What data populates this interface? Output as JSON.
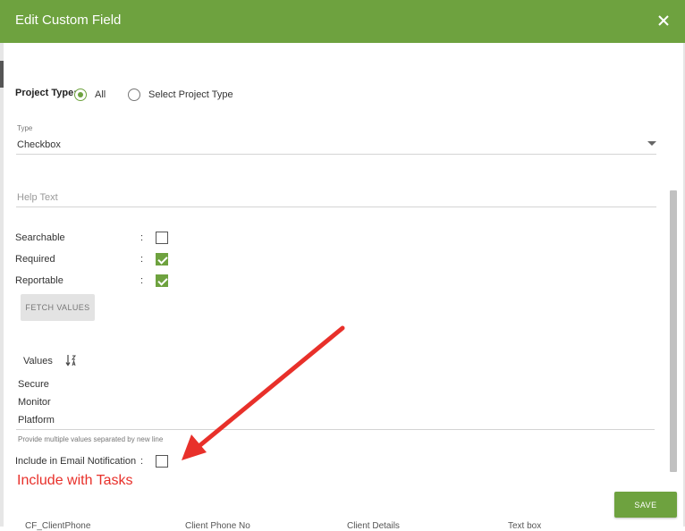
{
  "dialog": {
    "title": "Edit Custom Field",
    "close_icon": "close-icon"
  },
  "project_type": {
    "label": "Project Type:",
    "options": [
      {
        "label": "All",
        "selected": true
      },
      {
        "label": "Select Project Type",
        "selected": false
      }
    ]
  },
  "type_field": {
    "label": "Type",
    "value": "Checkbox"
  },
  "help_text": {
    "placeholder": "Help Text",
    "value": ""
  },
  "flags": [
    {
      "label": "Searchable",
      "checked": false
    },
    {
      "label": "Required",
      "checked": true
    },
    {
      "label": "Reportable",
      "checked": true
    }
  ],
  "separator": ":",
  "fetch_button": "FETCH VALUES",
  "values_section": {
    "label": "Values",
    "sort_icon": "sort-alpha-icon",
    "items": [
      "Secure",
      "Monitor",
      "Platform"
    ],
    "hint": "Provide multiple values separated by new line"
  },
  "email_notification": {
    "label": "Include in Email Notification",
    "checked": false
  },
  "annotation": {
    "text": "Include with Tasks",
    "color": "#e8302a"
  },
  "save_button": "SAVE",
  "background_row": [
    "CF_ClientPhone",
    "Client Phone No",
    "Client Details",
    "Text box"
  ],
  "colors": {
    "accent": "#6ea23f",
    "annotation": "#e8302a"
  }
}
